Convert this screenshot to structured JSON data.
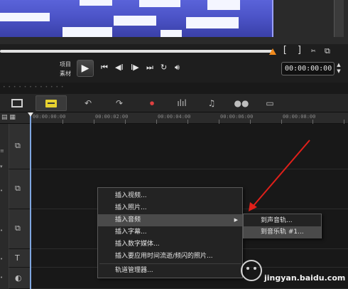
{
  "transport": {
    "mode_project": "项目",
    "mode_clip": "素材",
    "play_icon": "play-icon",
    "timecode": "00:00:00:00",
    "mark_in": "[",
    "mark_out": "]"
  },
  "ruler": {
    "labels": [
      "00:00:00:00",
      "00:00:02:00",
      "00:00:04:00",
      "00:00:06:00",
      "00:00:08:00"
    ]
  },
  "context_menu": {
    "items": [
      {
        "label": "插入视频..."
      },
      {
        "label": "插入照片..."
      },
      {
        "label": "插入音频"
      },
      {
        "label": "插入字幕..."
      },
      {
        "label": "插入数字媒体..."
      },
      {
        "label": "插入要应用时间流逝/频闪的照片..."
      },
      {
        "label": "轨道管理器..."
      }
    ],
    "submenu_arrow": "▶"
  },
  "submenu": {
    "items": [
      {
        "label": "到声音轨..."
      },
      {
        "label": "到音乐轨 #1..."
      }
    ]
  },
  "watermark": {
    "text": "jingyan.baidu.com"
  },
  "colors": {
    "accent_orange": "#f08a1d",
    "annotation_red": "#e0201a",
    "playhead_blue": "#7fa6e0"
  }
}
